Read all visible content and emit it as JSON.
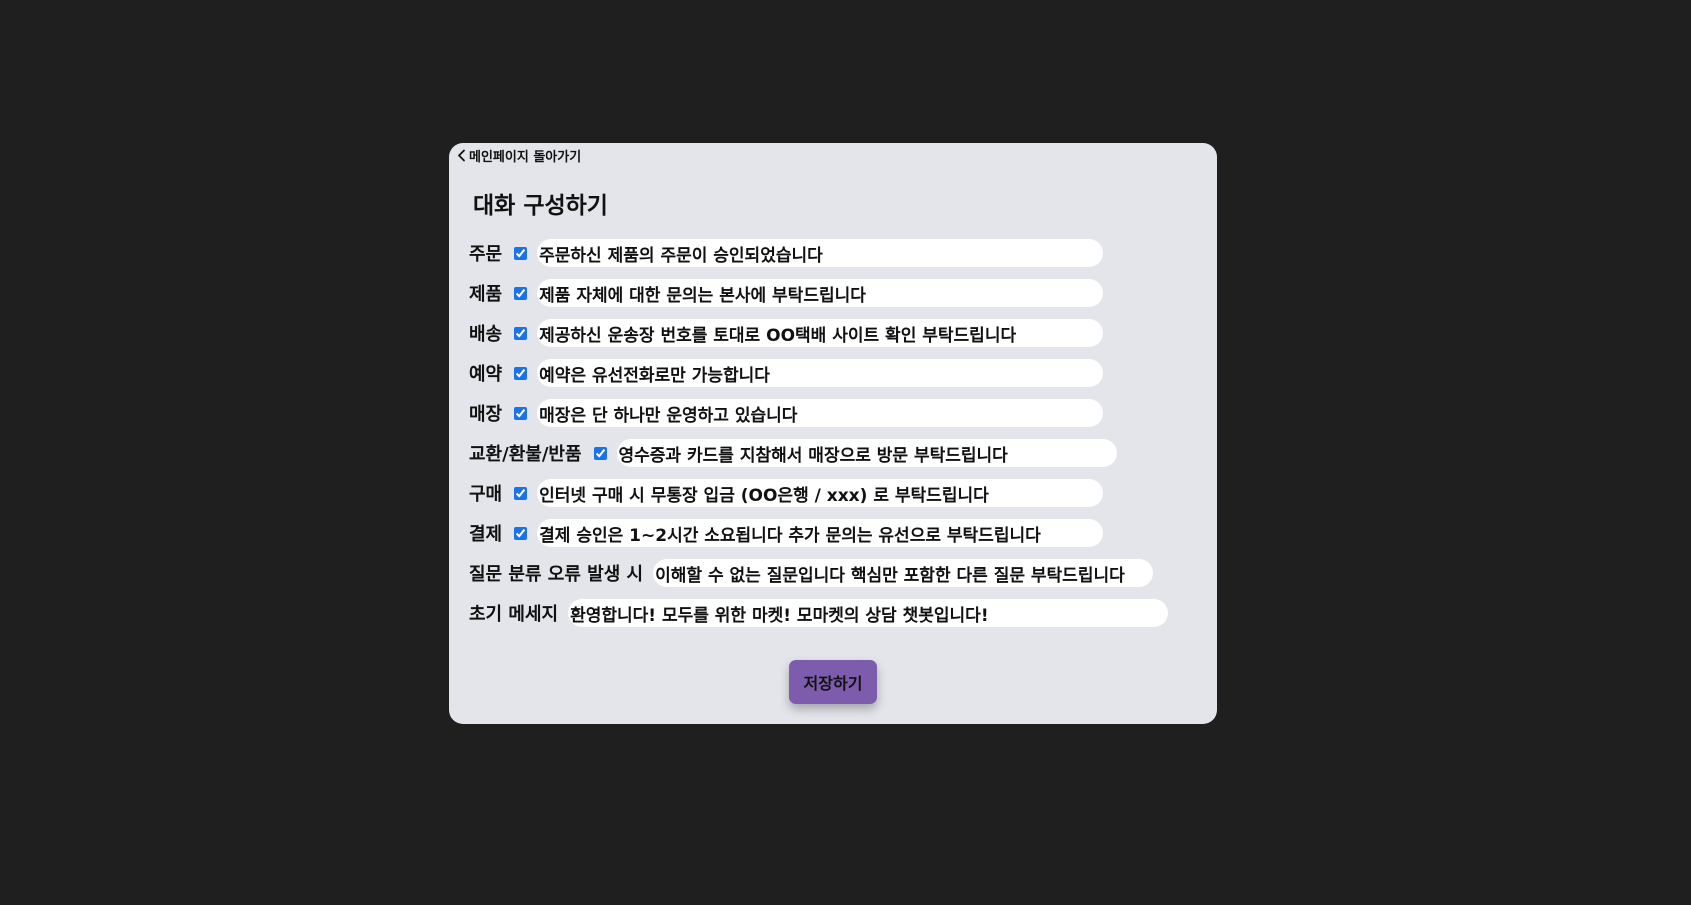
{
  "back_link": {
    "label": "메인페이지 돌아가기"
  },
  "title": "대화 구성하기",
  "rows": [
    {
      "label": "주문",
      "checked": true,
      "value": "주문하신 제품의 주문이 승인되었습니다"
    },
    {
      "label": "제품",
      "checked": true,
      "value": "제품 자체에 대한 문의는 본사에 부탁드립니다"
    },
    {
      "label": "배송",
      "checked": true,
      "value": "제공하신 운송장 번호를 토대로 OO택배 사이트 확인 부탁드립니다"
    },
    {
      "label": "예약",
      "checked": true,
      "value": "예약은 유선전화로만 가능합니다"
    },
    {
      "label": "매장",
      "checked": true,
      "value": "매장은 단 하나만 운영하고 있습니다"
    },
    {
      "label": "교환/환불/반품",
      "checked": true,
      "value": "영수증과 카드를 지참해서 매장으로 방문 부탁드립니다"
    },
    {
      "label": "구매",
      "checked": true,
      "value": "인터넷 구매 시 무통장 입금 (OO은행 / xxx) 로 부탁드립니다"
    },
    {
      "label": "결제",
      "checked": true,
      "value": "결제 승인은 1~2시간 소요됩니다 추가 문의는 유선으로 부탁드립니다"
    },
    {
      "label": "질문 분류 오류 발생 시",
      "value": "이해할 수 없는 질문입니다 핵심만 포함한 다른 질문 부탁드립니다"
    },
    {
      "label": "초기 메세지",
      "value": "환영합니다! 모두를 위한 마켓! 모마켓의 상담 챗봇입니다!"
    }
  ],
  "save_button": {
    "label": "저장하기"
  },
  "colors": {
    "background": "#1f1f1f",
    "card": "#e4e5ea",
    "input": "#ffffff",
    "accent": "#7e5cad",
    "checkbox": "#1a73e8"
  }
}
